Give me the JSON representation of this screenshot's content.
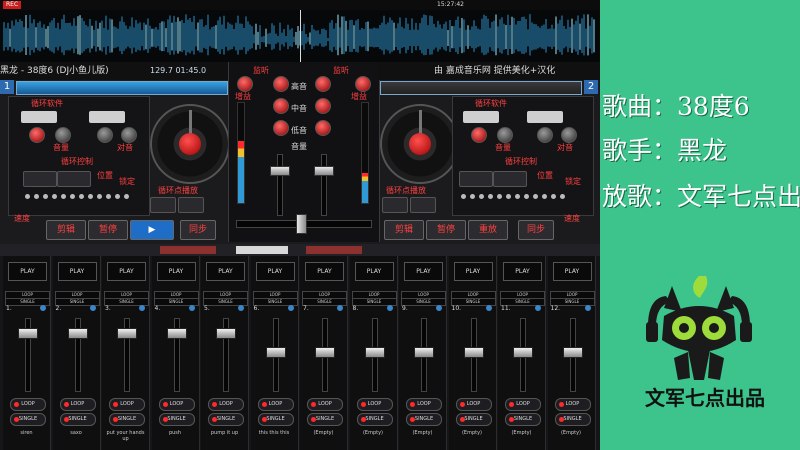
{
  "topbar": {
    "rec_label": "REC",
    "clock": "15:27:42"
  },
  "deck_left": {
    "title": "黑龙 - 38度6 (DJ小鱼儿版)",
    "bpm": "129.7",
    "time": "01:45.0",
    "deck_number": "1",
    "labels": {
      "loop_soft": "循环软件",
      "loop_control": "循环控制",
      "volume": "音量",
      "pitch": "对音",
      "beat_a": "节拍",
      "pos": "位置",
      "lock": "锁定",
      "loop_smooth": "循环点播放",
      "speed": "速度"
    },
    "buttons": {
      "cue": "剪辑",
      "pause": "暂停",
      "sync": "同步"
    }
  },
  "deck_right": {
    "title": "由 嘉成音乐网 提供美化+汉化",
    "deck_number": "2",
    "labels": {
      "loop_soft": "循环软件",
      "loop_control": "循环控制",
      "volume": "音量",
      "pitch": "对音",
      "pos": "位置",
      "lock": "锁定",
      "loop_smooth": "循环点播放",
      "speed": "速度"
    },
    "buttons": {
      "cue": "剪辑",
      "pause": "暂停",
      "rewind": "重放",
      "sync": "同步"
    }
  },
  "mixer": {
    "labels": {
      "monitor_l": "监听",
      "monitor_r": "监听",
      "gain_l": "增益",
      "gain_r": "增益",
      "high": "高音",
      "mid": "中音",
      "low": "低音",
      "volume": "音量"
    }
  },
  "sampler": {
    "play_label": "PLAY",
    "loop_label": "LOOP",
    "single_label": "SINGLE",
    "slots": [
      {
        "num": "1.",
        "name": "siren",
        "level": 0.85
      },
      {
        "num": "2.",
        "name": "saxo",
        "level": 0.85
      },
      {
        "num": "3.",
        "name": "put your hands up",
        "level": 0.85
      },
      {
        "num": "4.",
        "name": "push",
        "level": 0.85
      },
      {
        "num": "5.",
        "name": "pump it up",
        "level": 0.85
      },
      {
        "num": "6.",
        "name": "this this this",
        "level": 0.55
      },
      {
        "num": "7.",
        "name": "(Empty)",
        "level": 0.55
      },
      {
        "num": "8.",
        "name": "(Empty)",
        "level": 0.55
      },
      {
        "num": "9.",
        "name": "(Empty)",
        "level": 0.55
      },
      {
        "num": "10.",
        "name": "(Empty)",
        "level": 0.55
      },
      {
        "num": "11.",
        "name": "(Empty)",
        "level": 0.55
      },
      {
        "num": "12.",
        "name": "(Empty)",
        "level": 0.55
      }
    ]
  },
  "song_info": {
    "song": "歌曲：38度6",
    "singer": "歌手：黑龙",
    "player": "放歌：文军七点出品"
  },
  "brand": {
    "text": "文军七点出品"
  },
  "colors": {
    "accent_red": "#ff4040",
    "side_green": "#3cc48c",
    "deck_blue": "#2d6ab0"
  }
}
